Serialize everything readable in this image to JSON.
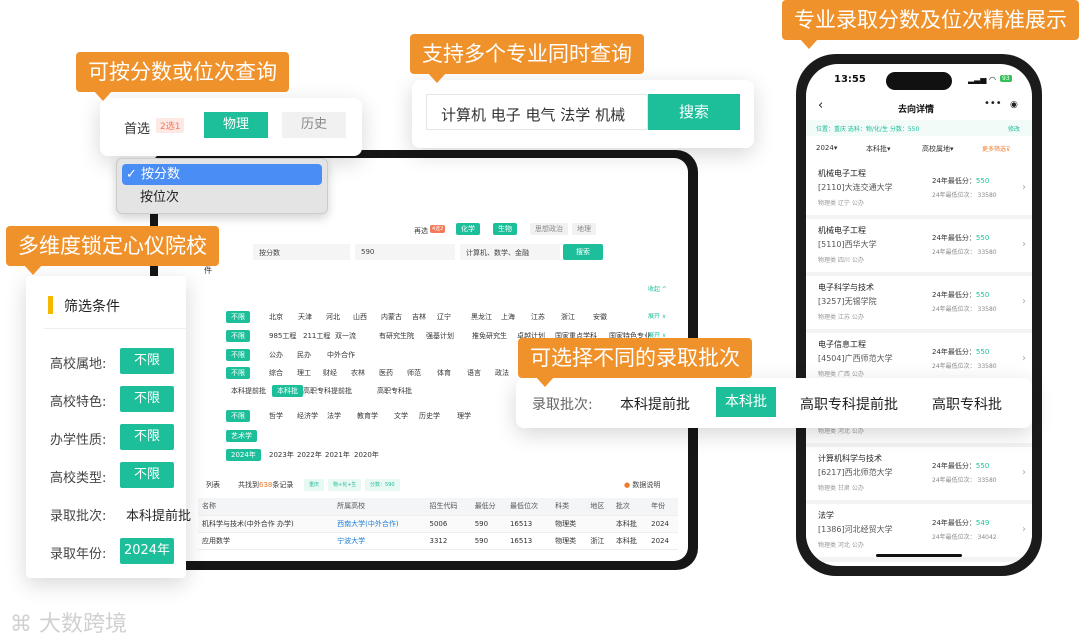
{
  "callouts": {
    "score_rank": "可按分数或位次查询",
    "multi_major": "支持多个专业同时查询",
    "precise": "专业录取分数及位次精准展示",
    "multi_dim": "多维度锁定心仪院校",
    "batch": "可选择不同的录取批次"
  },
  "subject_card": {
    "label": "首选",
    "badge": "2选1",
    "options": [
      "物理",
      "历史"
    ]
  },
  "dropdown": {
    "options": [
      "✓ 按分数",
      "按位次"
    ]
  },
  "search": {
    "value": "计算机 电子 电气 法学 机械",
    "button": "搜索"
  },
  "tablet": {
    "reselect_label": "再选",
    "reselect_badge": "4选2",
    "reselect_options": [
      "化学",
      "生物",
      "思想政治",
      "地理"
    ],
    "query_type": "按分数",
    "query_value": "590",
    "majors": "计算机、数学、金融",
    "search": "搜索",
    "section_tail": "件",
    "collapse": "收起 ^",
    "expand": "展开 ∨",
    "rows": [
      {
        "chips": [
          "不限",
          "北京",
          "天津",
          "河北",
          "山西",
          "内蒙古",
          "吉林",
          "辽宁",
          "黑龙江",
          "上海",
          "江苏",
          "浙江",
          "安徽"
        ]
      },
      {
        "chips": [
          "不限",
          "985工程",
          "211工程",
          "双一流",
          "有研究生院",
          "强基计划",
          "推免研究生",
          "卓越计划",
          "国家重点学科",
          "国家特色专业"
        ]
      },
      {
        "chips": [
          "不限",
          "公办",
          "民办",
          "中外合作"
        ]
      },
      {
        "chips": [
          "不限",
          "综合",
          "理工",
          "财经",
          "农林",
          "医药",
          "师范",
          "体育",
          "语言",
          "政法",
          "艺术"
        ]
      },
      {
        "chips": [
          "本科提前批",
          "本科批",
          "高职专科提前批",
          "高职专科批"
        ]
      },
      {
        "chips": [
          "不限",
          "哲学",
          "经济学",
          "法学",
          "教育学",
          "文学",
          "历史学",
          "理学"
        ]
      },
      {
        "chips": [
          "艺术学"
        ]
      },
      {
        "chips": [
          "2024年",
          "2023年",
          "2022年",
          "2021年",
          "2020年"
        ]
      }
    ],
    "list_title": "列表",
    "found_prefix": "共找到",
    "found_count": "638",
    "found_suffix": "条记录",
    "tags": [
      "重庆",
      "物+化+生",
      "分数：590"
    ],
    "data_note": "数据说明",
    "columns": [
      "名称",
      "所属高校",
      "招生代码",
      "最低分",
      "最低位次",
      "科类",
      "地区",
      "批次",
      "年份"
    ],
    "table": [
      [
        "机科学与技术(中外合作 办学)",
        "西南大学(中外合作)",
        "5006",
        "590",
        "16513",
        "物理类",
        "",
        "本科批",
        "2024"
      ],
      [
        "应用数学",
        "宁波大学",
        "3312",
        "590",
        "16513",
        "物理类",
        "浙江",
        "本科批",
        "2024"
      ]
    ]
  },
  "phone": {
    "time": "13:55",
    "battery": "93",
    "title": "去向详情",
    "filter_line": "位置：重庆   选科：物/化/生   分数：550",
    "edit": "修改",
    "sel": [
      "2024▾",
      "本科批▾",
      "高校属地▾"
    ],
    "more": "更多筛选",
    "items": [
      {
        "name": "机械电子工程",
        "code": "[2110]大连交通大学",
        "meta": "物理类 辽宁 公办",
        "score": "550",
        "rank": "33580"
      },
      {
        "name": "机械电子工程",
        "code": "[5110]西华大学",
        "meta": "物理类 四川 公办",
        "score": "550",
        "rank": "33580"
      },
      {
        "name": "电子科学与技术",
        "code": "[3257]无锡学院",
        "meta": "物理类 江苏 公办",
        "score": "550",
        "rank": "33580"
      },
      {
        "name": "电子信息工程",
        "code": "[4504]广西师范大学",
        "meta": "物理类 广西 公办",
        "score": "550",
        "rank": "33580"
      },
      {
        "name": "",
        "code": "",
        "meta": "物理类 河北 公办",
        "score": "",
        "rank": ""
      },
      {
        "name": "计算机科学与技术",
        "code": "[6217]西北师范大学",
        "meta": "物理类 甘肃 公办",
        "score": "550",
        "rank": "33580"
      },
      {
        "name": "法学",
        "code": "[1386]河北经贸大学",
        "meta": "物理类 河北 公办",
        "score": "549",
        "rank": "34042"
      }
    ],
    "score_label": "24年最低分：",
    "rank_label": "24年最低位次："
  },
  "batch_card": {
    "label": "录取批次:",
    "options": [
      "本科提前批",
      "本科批",
      "高职专科提前批",
      "高职专科批"
    ],
    "selected": 1
  },
  "filter_card": {
    "title": "筛选条件",
    "rows": [
      {
        "label": "高校属地:",
        "value": "不限",
        "button": true
      },
      {
        "label": "高校特色:",
        "value": "不限",
        "button": true
      },
      {
        "label": "办学性质:",
        "value": "不限",
        "button": true
      },
      {
        "label": "高校类型:",
        "value": "不限",
        "button": true
      },
      {
        "label": "录取批次:",
        "value": "本科提前批",
        "button": false
      },
      {
        "label": "录取年份:",
        "value": "2024年",
        "button": true
      }
    ]
  },
  "watermark": "大数跨境",
  "colors": {
    "green": "#1cbf9a",
    "orange": "#f0922b"
  }
}
